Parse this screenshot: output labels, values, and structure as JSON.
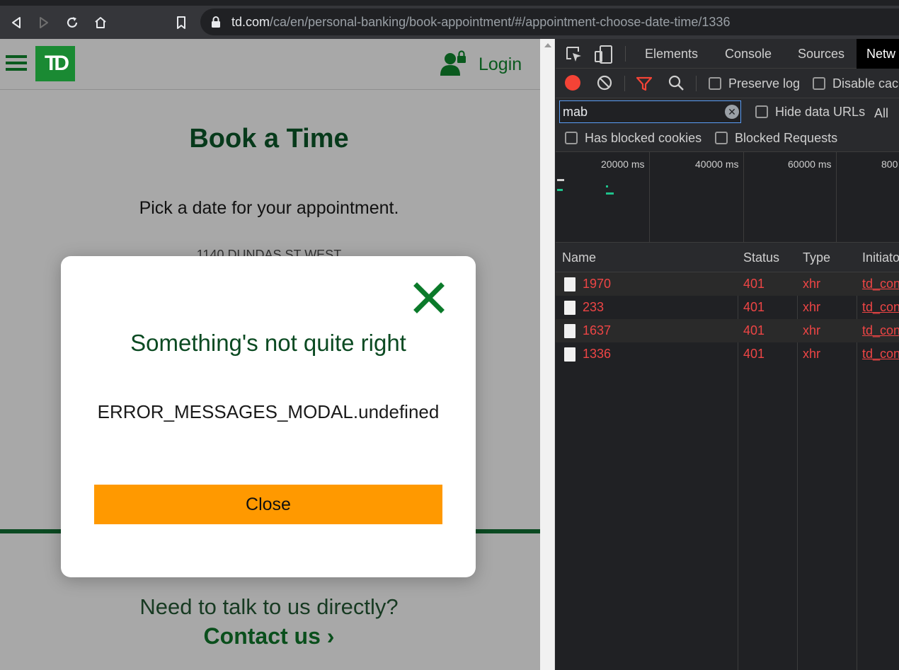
{
  "browser": {
    "url_host": "td.com",
    "url_path": "/ca/en/personal-banking/book-appointment/#/appointment-choose-date-time/1336"
  },
  "site": {
    "logo_text": "TD",
    "login_label": "Login",
    "page_title": "Book a Time",
    "page_subtitle": "Pick a date for your appointment.",
    "address": "1140 DUNDAS ST WEST",
    "talk_text": "Need to talk to us directly?",
    "contact_link": "Contact us ›"
  },
  "modal": {
    "title": "Something's not quite right",
    "message": "ERROR_MESSAGES_MODAL.undefined",
    "close_button": "Close"
  },
  "devtools": {
    "tabs": [
      "Elements",
      "Console",
      "Sources",
      "Netw"
    ],
    "active_tab": "Netw",
    "preserve_log": "Preserve log",
    "disable_cache": "Disable cac",
    "filter_value": "mab",
    "hide_data_urls": "Hide data URLs",
    "all_label": "All",
    "has_blocked_cookies": "Has blocked cookies",
    "blocked_requests": "Blocked Requests",
    "timeline_labels": [
      "20000 ms",
      "40000 ms",
      "60000 ms",
      "800"
    ],
    "columns": [
      "Name",
      "Status",
      "Type",
      "Initiato"
    ],
    "rows": [
      {
        "name": "1970",
        "status": "401",
        "type": "xhr",
        "initiator": "td_con"
      },
      {
        "name": "233",
        "status": "401",
        "type": "xhr",
        "initiator": "td_con"
      },
      {
        "name": "1637",
        "status": "401",
        "type": "xhr",
        "initiator": "td_con"
      },
      {
        "name": "1336",
        "status": "401",
        "type": "xhr",
        "initiator": "td_con"
      }
    ]
  },
  "colors": {
    "td_green": "#1a8a33",
    "dark_green": "#0b4a22",
    "close_button": "#ff9900",
    "error_red": "#ee4545",
    "record_red": "#f44336"
  }
}
